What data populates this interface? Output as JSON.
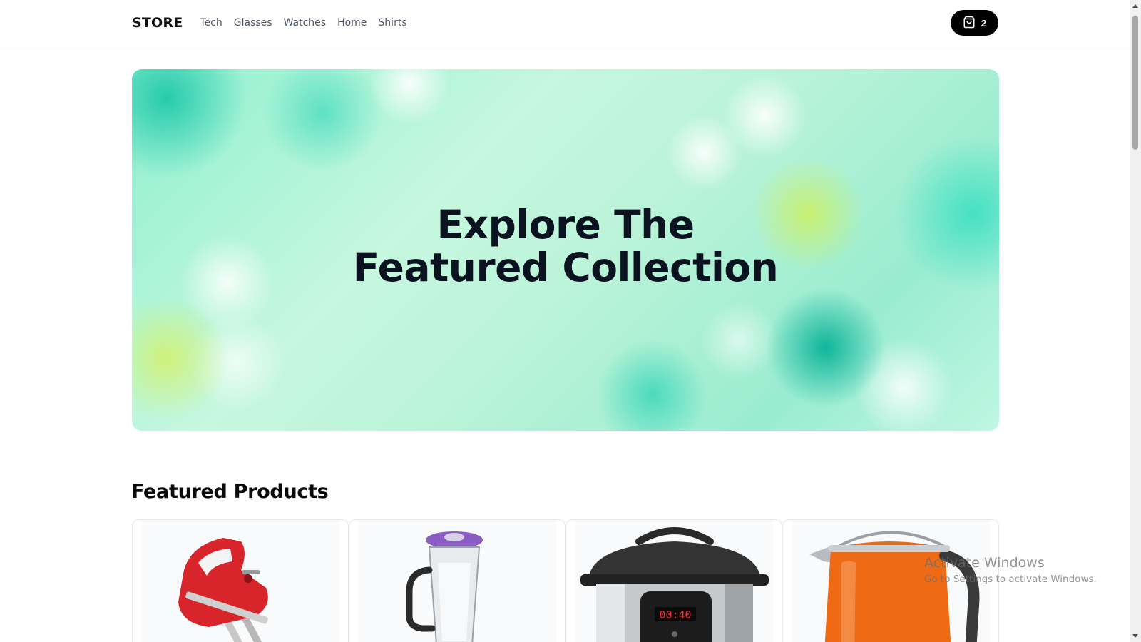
{
  "navbar": {
    "logo": "STORE",
    "links": [
      "Tech",
      "Glasses",
      "Watches",
      "Home",
      "Shirts"
    ],
    "cart": {
      "icon": "shopping-bag-icon",
      "count": "2"
    }
  },
  "hero": {
    "title_line1": "Explore The",
    "title_line2": "Featured Collection"
  },
  "featured": {
    "title": "Featured Products",
    "products": [
      {
        "image": "hand-mixer",
        "color": "#d8242b"
      },
      {
        "image": "blender",
        "color": "#8b5cc4"
      },
      {
        "image": "pressure-cooker",
        "display": "00:40"
      },
      {
        "image": "electric-kettle",
        "color": "#ef6a14"
      }
    ]
  },
  "watermark": {
    "line1": "Activate Windows",
    "line2": "Go to Settings to activate Windows."
  },
  "colors": {
    "accent": "#2563eb",
    "cart_button": "#000000",
    "hero_gradient": [
      "#8ff0cf",
      "#c6f7df",
      "#99ecd0"
    ]
  }
}
